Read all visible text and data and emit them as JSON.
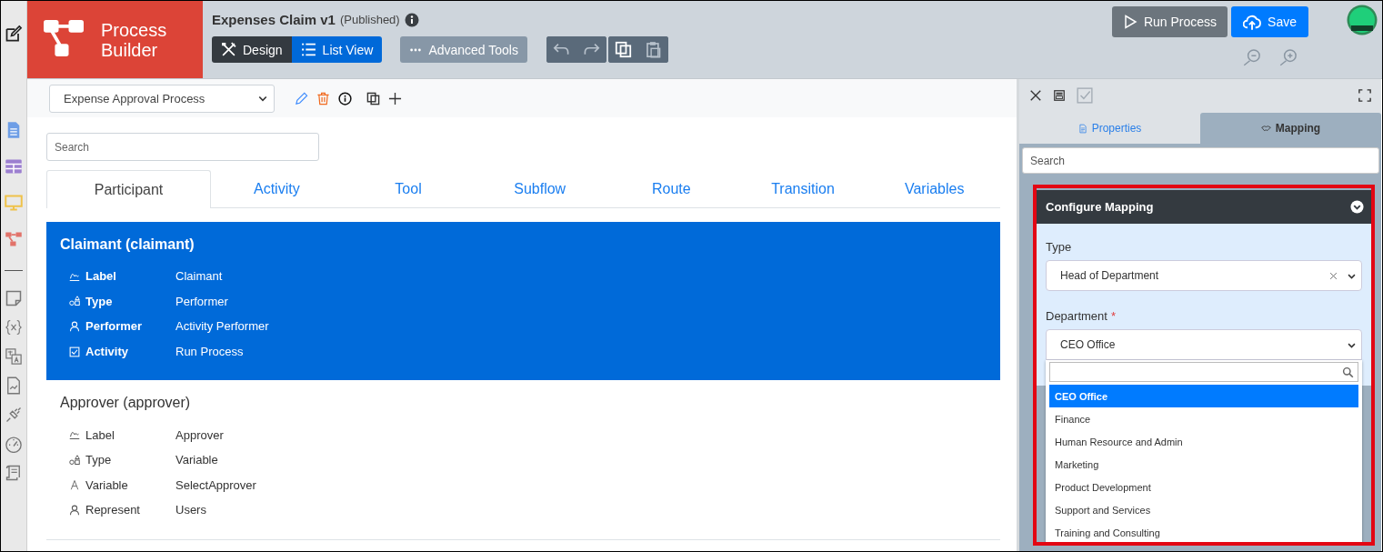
{
  "app": {
    "name": "Process Builder"
  },
  "header": {
    "title": "Expenses Claim v1",
    "status": "(Published)",
    "view_toggle": [
      {
        "label": "Design",
        "kind": "design",
        "selected": false
      },
      {
        "label": "List View",
        "kind": "list",
        "selected": true
      }
    ],
    "advanced_tools": "Advanced Tools",
    "run_button": "Run Process",
    "save_button": "Save"
  },
  "process_select": {
    "value": "Expense Approval Process"
  },
  "search": {
    "placeholder": "Search"
  },
  "tabs": [
    {
      "label": "Participant",
      "selected": true
    },
    {
      "label": "Activity",
      "selected": false
    },
    {
      "label": "Tool",
      "selected": false
    },
    {
      "label": "Subflow",
      "selected": false
    },
    {
      "label": "Route",
      "selected": false
    },
    {
      "label": "Transition",
      "selected": false
    },
    {
      "label": "Variables",
      "selected": false
    }
  ],
  "participants": [
    {
      "title": "Claimant (claimant)",
      "selected": true,
      "properties": [
        {
          "kind": "label",
          "name": "Label",
          "value": "Claimant"
        },
        {
          "kind": "type",
          "name": "Type",
          "value": "Performer"
        },
        {
          "kind": "person",
          "name": "Performer",
          "value": "Activity Performer"
        },
        {
          "kind": "activity",
          "name": "Activity",
          "value": "Run Process"
        }
      ]
    },
    {
      "title": "Approver (approver)",
      "selected": false,
      "properties": [
        {
          "kind": "label",
          "name": "Label",
          "value": "Approver"
        },
        {
          "kind": "type",
          "name": "Type",
          "value": "Variable"
        },
        {
          "kind": "variable",
          "name": "Variable",
          "value": "SelectApprover"
        },
        {
          "kind": "person",
          "name": "Represent",
          "value": "Users"
        }
      ]
    }
  ],
  "panel": {
    "tabs": [
      {
        "label": "Properties",
        "kind": "properties",
        "selected": false
      },
      {
        "label": "Mapping",
        "kind": "mapping",
        "selected": true
      }
    ],
    "search": {
      "placeholder": "Search"
    },
    "mapping": {
      "title": "Configure Mapping",
      "fields": [
        {
          "label": "Type",
          "value": "Head of Department",
          "clearable": true
        },
        {
          "label": "Department",
          "required_mark": "*",
          "value": "CEO Office",
          "clearable": false,
          "open": true
        }
      ],
      "options": [
        {
          "label": "CEO Office",
          "selected": true
        },
        {
          "label": "Finance",
          "selected": false
        },
        {
          "label": "Human Resource and Admin",
          "selected": false
        },
        {
          "label": "Marketing",
          "selected": false
        },
        {
          "label": "Product Development",
          "selected": false
        },
        {
          "label": "Support and Services",
          "selected": false
        },
        {
          "label": "Training and Consulting",
          "selected": false
        }
      ]
    }
  }
}
